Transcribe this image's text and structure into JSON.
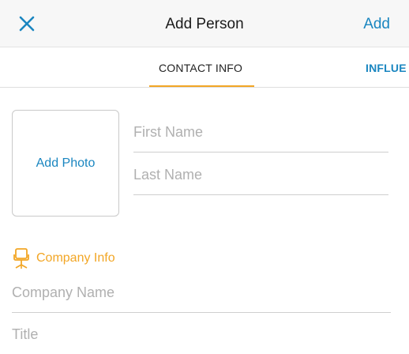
{
  "navbar": {
    "title": "Add Person",
    "add_label": "Add",
    "close_icon": "close-icon"
  },
  "tabs": [
    {
      "label": "CONTACT INFO",
      "selected": true
    },
    {
      "label": "INFLUE",
      "selected": false
    }
  ],
  "photo": {
    "label": "Add Photo"
  },
  "fields": {
    "first_name": {
      "placeholder": "First Name",
      "value": ""
    },
    "last_name": {
      "placeholder": "Last Name",
      "value": ""
    },
    "company_name": {
      "placeholder": "Company Name",
      "value": ""
    },
    "title": {
      "placeholder": "Title",
      "value": ""
    }
  },
  "company_section": {
    "title": "Company Info",
    "icon": "office-chair-icon"
  },
  "colors": {
    "accent_blue": "#1a86c0",
    "accent_orange": "#f2a625",
    "navbar_bg": "#f7f7f7"
  }
}
